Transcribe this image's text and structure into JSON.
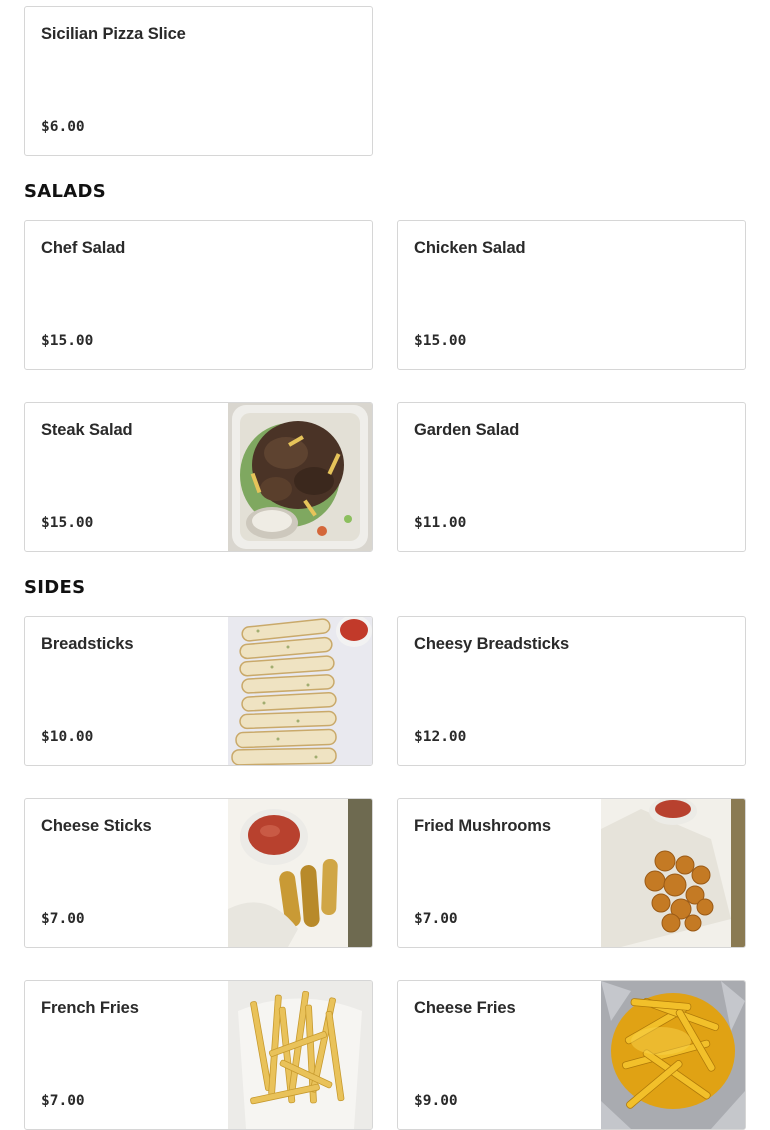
{
  "sections": [
    {
      "title": "",
      "items": [
        {
          "name": "Sicilian Pizza Slice",
          "price": "$6.00",
          "photo": null
        }
      ]
    },
    {
      "title": "SALADS",
      "items": [
        {
          "name": "Chef Salad",
          "price": "$15.00",
          "photo": null
        },
        {
          "name": "Chicken Salad",
          "price": "$15.00",
          "photo": null
        },
        {
          "name": "Steak Salad",
          "price": "$15.00",
          "photo": "steak-salad-photo"
        },
        {
          "name": "Garden Salad",
          "price": "$11.00",
          "photo": null
        }
      ]
    },
    {
      "title": "SIDES",
      "items": [
        {
          "name": "Breadsticks",
          "price": "$10.00",
          "photo": "breadsticks-photo"
        },
        {
          "name": "Cheesy Breadsticks",
          "price": "$12.00",
          "photo": null
        },
        {
          "name": "Cheese Sticks",
          "price": "$7.00",
          "photo": "cheese-sticks-photo"
        },
        {
          "name": "Fried Mushrooms",
          "price": "$7.00",
          "photo": "fried-mushrooms-photo"
        },
        {
          "name": "French Fries",
          "price": "$7.00",
          "photo": "french-fries-photo"
        },
        {
          "name": "Cheese Fries",
          "price": "$9.00",
          "photo": "cheese-fries-photo"
        }
      ]
    }
  ]
}
